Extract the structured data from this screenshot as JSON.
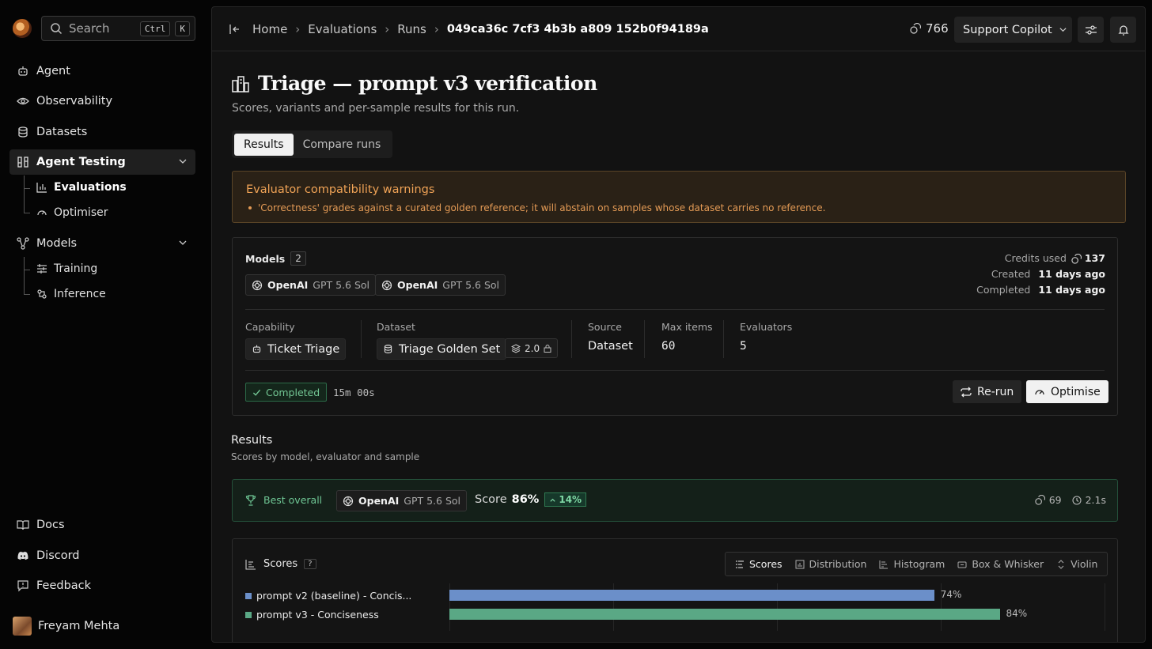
{
  "sidebar": {
    "search": {
      "label": "Search",
      "kbd1": "Ctrl",
      "kbd2": "K"
    },
    "nav": [
      {
        "label": "Agent"
      },
      {
        "label": "Observability"
      },
      {
        "label": "Datasets"
      },
      {
        "label": "Agent Testing"
      },
      {
        "label": "Models"
      }
    ],
    "agent_testing_sub": [
      {
        "label": "Evaluations"
      },
      {
        "label": "Optimiser"
      }
    ],
    "models_sub": [
      {
        "label": "Training"
      },
      {
        "label": "Inference"
      }
    ],
    "footer": [
      {
        "label": "Docs"
      },
      {
        "label": "Discord"
      },
      {
        "label": "Feedback"
      }
    ],
    "user": {
      "name": "Freyam Mehta"
    }
  },
  "topbar": {
    "breadcrumbs": [
      "Home",
      "Evaluations",
      "Runs"
    ],
    "current": "049ca36c 7cf3 4b3b a809 152b0f94189a",
    "credits": "766",
    "agent": "Support Copilot"
  },
  "page": {
    "title": "Triage — prompt v3 verification",
    "subtitle": "Scores, variants and per-sample results for this run.",
    "tabs": [
      "Results",
      "Compare runs"
    ]
  },
  "warning": {
    "title": "Evaluator compatibility warnings",
    "item": "'Correctness' grades against a curated golden reference; it will abstain on samples whose dataset carries no reference."
  },
  "run": {
    "models_label": "Models",
    "models_count": "2",
    "models": [
      {
        "provider": "OpenAI",
        "name": "GPT 5.6 Sol"
      },
      {
        "provider": "OpenAI",
        "name": "GPT 5.6 Sol"
      }
    ],
    "meta": {
      "credits_label": "Credits used",
      "credits": "137",
      "created_label": "Created",
      "created": "11 days ago",
      "completed_label": "Completed",
      "completed": "11 days ago"
    },
    "capability_label": "Capability",
    "capability": "Ticket Triage",
    "dataset_label": "Dataset",
    "dataset": "Triage Golden Set",
    "dataset_version": "2.0",
    "source_label": "Source",
    "source": "Dataset",
    "max_items_label": "Max items",
    "max_items": "60",
    "evaluators_label": "Evaluators",
    "evaluators": "5",
    "status": "Completed",
    "duration": "15m 00s",
    "rerun_label": "Re-run",
    "optimise_label": "Optimise"
  },
  "results": {
    "title": "Results",
    "subtitle": "Scores by model, evaluator and sample",
    "best": {
      "label": "Best overall",
      "provider": "OpenAI",
      "model": "GPT 5.6 Sol",
      "score_label": "Score",
      "score": "86%",
      "delta": "14%",
      "credits": "69",
      "time": "2.1s"
    }
  },
  "scores": {
    "title": "Scores",
    "help": "?",
    "views": [
      "Scores",
      "Distribution",
      "Histogram",
      "Box & Whisker",
      "Violin"
    ],
    "active_view": "Scores",
    "colors": {
      "baseline": "#6b8fc9",
      "v3": "#5aa885"
    }
  },
  "chart_data": {
    "type": "bar",
    "orientation": "horizontal",
    "categories": [
      "prompt v2 (baseline) - Concis...",
      "prompt v3 - Conciseness"
    ],
    "values": [
      74,
      84
    ],
    "value_labels": [
      "74%",
      "84%"
    ],
    "xlim": [
      0,
      100
    ]
  }
}
